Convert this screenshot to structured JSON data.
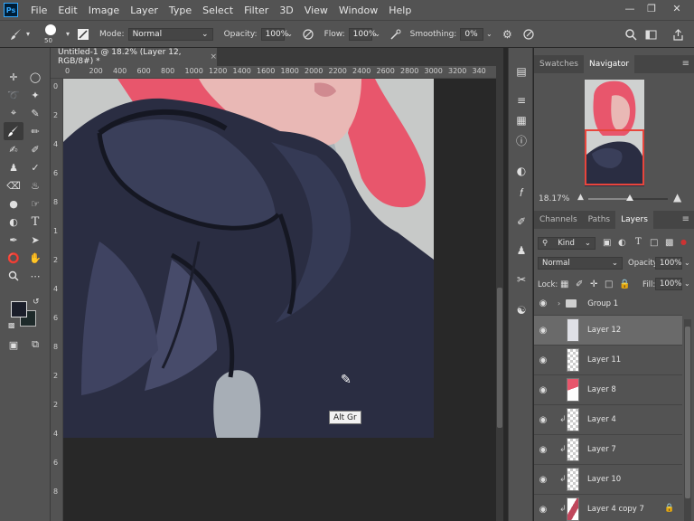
{
  "menu": {
    "logo": "Ps",
    "items": [
      "File",
      "Edit",
      "Image",
      "Layer",
      "Type",
      "Select",
      "Filter",
      "3D",
      "View",
      "Window",
      "Help"
    ],
    "window_controls": [
      "—",
      "❐",
      "✕"
    ]
  },
  "options": {
    "brush_size": "50",
    "mode_label": "Mode:",
    "mode_value": "Normal",
    "opacity_label": "Opacity:",
    "opacity_value": "100%",
    "flow_label": "Flow:",
    "flow_value": "100%",
    "smoothing_label": "Smoothing:",
    "smoothing_value": "0%"
  },
  "document": {
    "tab_title": "Untitled-1 @ 18.2% (Layer 12, RGB/8#) *",
    "close_symbol": "×"
  },
  "ruler": {
    "h_ticks": [
      "0",
      "200",
      "400",
      "600",
      "800",
      "1000",
      "1200",
      "1400",
      "1600",
      "1800",
      "2000",
      "2200",
      "2400",
      "2600",
      "2800",
      "3000",
      "3200",
      "340"
    ],
    "v_ticks": [
      "0",
      "2",
      "4",
      "6",
      "8",
      "1",
      "2",
      "4",
      "6",
      "8",
      "2",
      "2",
      "4",
      "6",
      "8"
    ]
  },
  "tooltip": "Alt Gr",
  "colors": {
    "foreground": "#1b1e2a",
    "background": "#1e2a2a",
    "accent_red": "#e8453c",
    "hair": "#e8566c",
    "coat": "#2a2d42"
  },
  "navigator": {
    "tabs": [
      "Swatches",
      "Navigator"
    ],
    "active_tab": "Navigator",
    "zoom": "18.17%",
    "zoom_position": 0.52
  },
  "layers_panel": {
    "tabs": [
      "Channels",
      "Paths",
      "Layers"
    ],
    "active_tab": "Layers",
    "filter_kind": "Kind",
    "blend_mode": "Normal",
    "opacity_label": "Opacity:",
    "opacity_value": "100%",
    "lock_label": "Lock:",
    "fill_label": "Fill:",
    "fill_value": "100%",
    "layers": [
      {
        "name": "Group 1",
        "type": "group",
        "selected": false,
        "clipped": false,
        "locked": false
      },
      {
        "name": "Layer 12",
        "type": "layer",
        "selected": true,
        "clipped": false,
        "locked": false
      },
      {
        "name": "Layer 11",
        "type": "layer",
        "selected": false,
        "clipped": false,
        "locked": false
      },
      {
        "name": "Layer 8",
        "type": "layer",
        "selected": false,
        "clipped": false,
        "locked": false
      },
      {
        "name": "Layer 4",
        "type": "layer",
        "selected": false,
        "clipped": true,
        "locked": false
      },
      {
        "name": "Layer 7",
        "type": "layer",
        "selected": false,
        "clipped": true,
        "locked": false
      },
      {
        "name": "Layer 10",
        "type": "layer",
        "selected": false,
        "clipped": true,
        "locked": false
      },
      {
        "name": "Layer 4 copy 7",
        "type": "layer",
        "selected": false,
        "clipped": true,
        "locked": true
      }
    ]
  },
  "icons": {
    "eye": "eye-icon",
    "lock": "lock-icon",
    "folder": "folder-icon",
    "clip": "clipping-arrow-icon"
  }
}
